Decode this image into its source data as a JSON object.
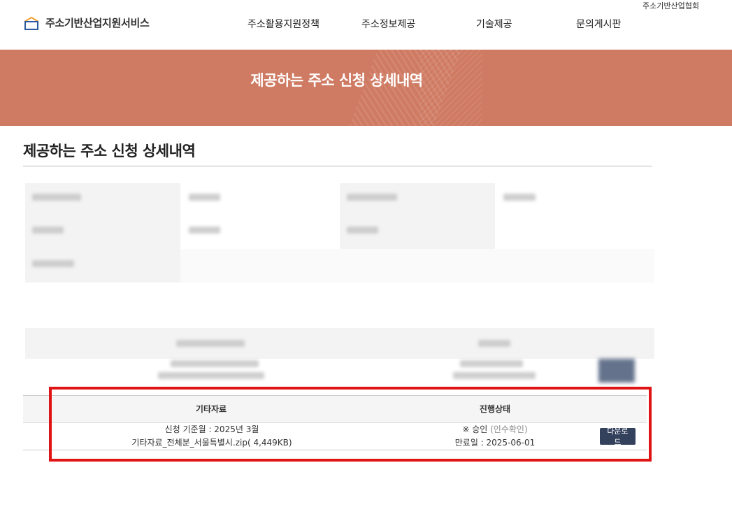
{
  "header": {
    "top_right_link": "주소기반산업협회",
    "logo_text": "주소기반산업지원서비스",
    "nav": [
      "주소활용지원정책",
      "주소정보제공",
      "기술제공",
      "문의게시판"
    ]
  },
  "banner": {
    "title": "제공하는 주소 신청 상세내역"
  },
  "section": {
    "title": "제공하는 주소 신청 상세내역"
  },
  "detail_table": {
    "headers": [
      "기타자료",
      "진행상태"
    ],
    "row": {
      "line1": "신청 기준월 : 2025년 3월",
      "line2": "기타자료_전체분_서울특별시.zip( 4,449KB)",
      "status_prefix": "※ 승인",
      "status_note": "(인수확인)",
      "expiry": "만료일 : 2025-06-01",
      "download_label": "다운로드"
    }
  },
  "colors": {
    "banner": "#cf7a62",
    "button": "#34415d",
    "highlight": "#e01414"
  }
}
